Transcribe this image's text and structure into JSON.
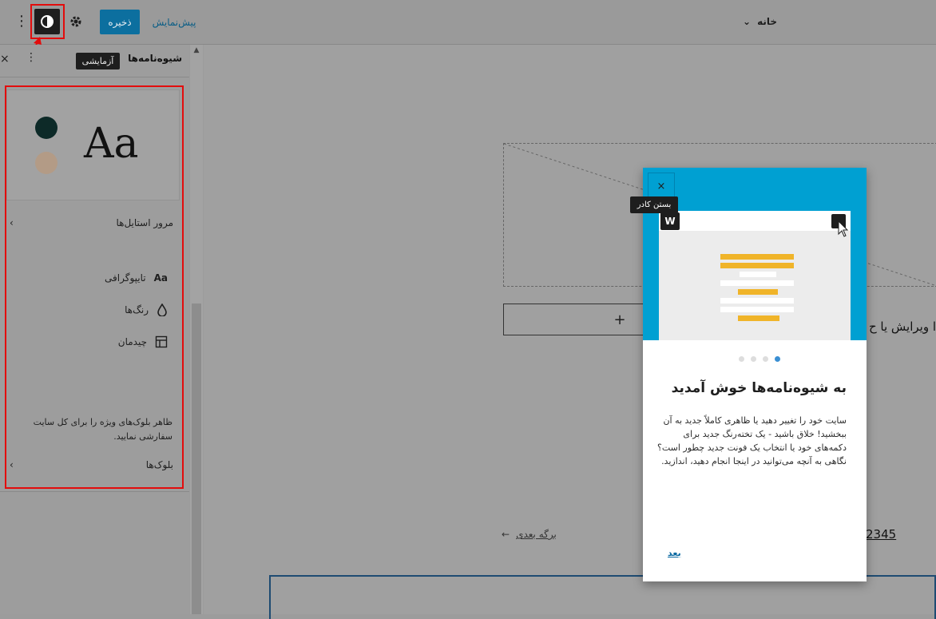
{
  "topbar": {
    "home_title": "خانه",
    "save_label": "ذخیره",
    "preview_label": "پیش‌نمایش"
  },
  "sidebar": {
    "title": "شیوه‌نامه‌ها",
    "badge": "آزمایشی",
    "preview_sample": "Aa",
    "swatch_colors": [
      "#0d2a28",
      "#b39b86"
    ],
    "browse_label": "مرور استایل‌ها",
    "items": [
      {
        "label": "تایپوگرافی",
        "icon": "typography-icon"
      },
      {
        "label": "رنگ‌ها",
        "icon": "droplet-icon"
      },
      {
        "label": "چیدمان",
        "icon": "layout-icon"
      }
    ],
    "blocks_description": "ظاهر بلوک‌های ویژه را برای کل سایت سفارشی نمایید.",
    "blocks_label": "بلوک‌ها"
  },
  "canvas": {
    "add_symbol": "+",
    "partial_text": "ا ویرایش یا ح",
    "next_page": "برگه بعدی",
    "next_arrow": "←",
    "page_numbers": "2345"
  },
  "modal": {
    "close_symbol": "×",
    "close_tooltip": "بستن کادر",
    "title": "به شیوه‌نامه‌ها خوش آمدید",
    "body": "سایت خود را تغییر دهید یا ظاهری کاملاً جدید به آن ببخشید! خلاق باشید - یک تخته‌رنگ جدید برای دکمه‌های خود یا انتخاب یک فونت جدید چطور است؟ نگاهی به آنچه می‌توانید در اینجا انجام دهید، اندازید.",
    "next_label": "بعد",
    "total_steps": 4,
    "current_step": 1
  },
  "colors": {
    "accent_blue": "#00a0d2",
    "annotation_red": "#e30c0c",
    "save_button": "#0c6f9f"
  }
}
